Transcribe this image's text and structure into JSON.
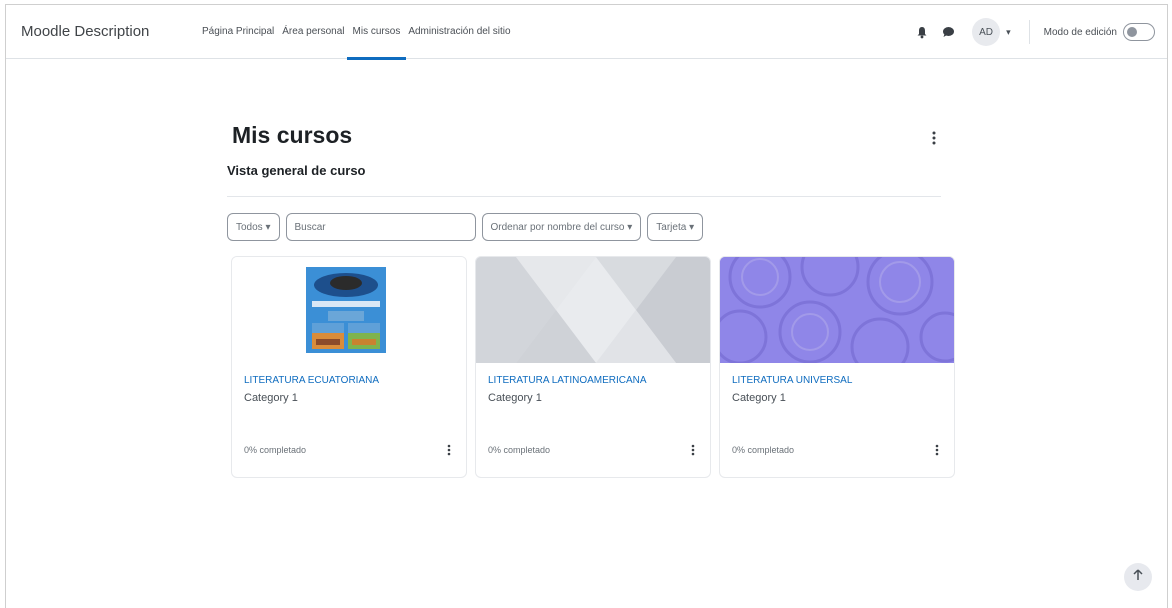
{
  "navbar": {
    "brand": "Moodle Description",
    "links": [
      "Página Principal",
      "Área personal",
      "Mis cursos",
      "Administración del sitio"
    ],
    "active_link": "Mis cursos",
    "avatar_initials": "AD",
    "avatar_caret": "▾",
    "edit_mode_label": "Modo de edición",
    "edit_mode_on": false
  },
  "main": {
    "title": "Mis cursos",
    "block_title": "Vista general de curso",
    "filters": {
      "grouping": "Todos",
      "search_placeholder": "Buscar",
      "sort": "Ordenar por nombre del curso",
      "view": "Tarjeta",
      "caret": "▾"
    },
    "courses": [
      {
        "name": "LITERATURA ECUATORIANA",
        "category": "Category 1",
        "progress": "0% completado",
        "image": "photo-collage"
      },
      {
        "name": "LITERATURA LATINOAMERICANA",
        "category": "Category 1",
        "progress": "0% completado",
        "image": "grey-geometric"
      },
      {
        "name": "LITERATURA UNIVERSAL",
        "category": "Category 1",
        "progress": "0% completado",
        "image": "purple-circles"
      }
    ]
  },
  "colors": {
    "primary": "#0f6cbf",
    "text": "#1d2125",
    "muted": "#6a7178",
    "purple": "#8f86e8"
  },
  "icons": [
    "bell-icon",
    "chat-icon",
    "kebab-icon",
    "arrow-up-icon"
  ]
}
